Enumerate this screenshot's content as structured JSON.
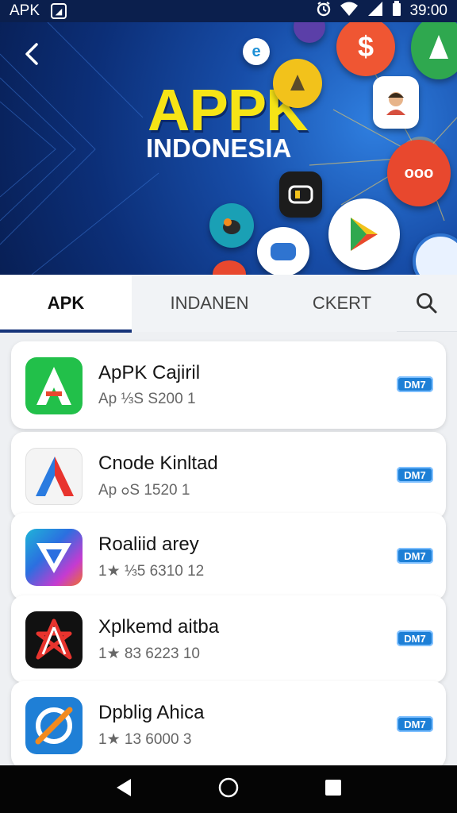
{
  "status_bar": {
    "carrier": "APK",
    "time": "39:00",
    "app_icon": "app-store-icon",
    "icons": [
      "alarm-icon",
      "wifi-icon",
      "signal-icon",
      "battery-icon"
    ]
  },
  "banner": {
    "title": "APPK",
    "subtitle": "INDONESIA",
    "back_icon": "back-arrow-icon",
    "bubble_texts": [
      "e",
      "$",
      "ooo"
    ]
  },
  "tabs": [
    {
      "label": "APK",
      "active": true
    },
    {
      "label": "INDANEN",
      "active": false
    },
    {
      "label": "CKERT",
      "active": false
    }
  ],
  "search_icon": "search-icon",
  "apps": [
    {
      "name": "ApPK Cajiril",
      "meta": "Ap ⅓S S200  1",
      "badge": "DM7"
    },
    {
      "name": "Cnode Kinltad",
      "meta": "Ap ߋS 1520  1",
      "badge": "DM7"
    },
    {
      "name": "Roaliid arey",
      "meta": "1★ ⅓5 6310  12",
      "badge": "DM7"
    },
    {
      "name": "Xplkemd aitba",
      "meta": "1★ 83 6223  10",
      "badge": "DM7"
    },
    {
      "name": "Dpblig Ahica",
      "meta": "1★ 13 6000  3",
      "badge": "DM7"
    }
  ],
  "colors": {
    "status_bar": "#0b1f4d",
    "banner_title": "#f6e416",
    "accent": "#16347a",
    "download_badge": "#1d7fd6"
  },
  "nav_bar": {
    "icons": [
      "back-triangle-icon",
      "home-circle-icon",
      "recents-square-icon"
    ]
  }
}
